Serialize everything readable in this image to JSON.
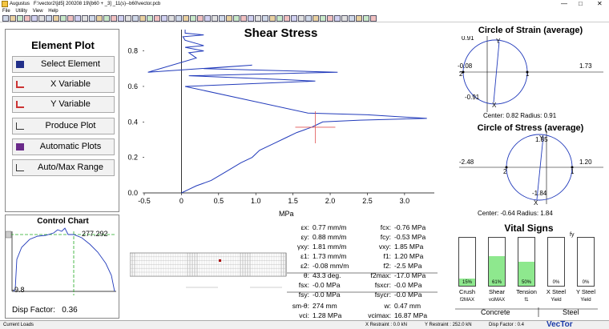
{
  "window": {
    "app_title": "Augustus",
    "path": "F:\\vector2\\[d5] 200208 19\\[b60 + _3] _11(s)--b60\\vector.pcb"
  },
  "menu": [
    "File",
    "Utility",
    "View",
    "Help"
  ],
  "left_panel": {
    "title": "Element Plot",
    "buttons": [
      "Select Element",
      "X Variable",
      "Y Variable",
      "Produce Plot",
      "Automatic Plots",
      "Auto/Max Range"
    ]
  },
  "control_chart": {
    "title": "Control Chart",
    "max_value": "277.292",
    "min_value": "-9.8",
    "disp_factor_label": "Disp Factor:",
    "disp_factor_value": "0.36"
  },
  "main_chart": {
    "title": "Shear Stress",
    "xlabel": "MPa",
    "xticks": [
      "-0.5",
      "0",
      "0.5",
      "1.0",
      "1.5",
      "2.0",
      "2.5",
      "3.0"
    ],
    "yticks": [
      "0.0",
      "0.2",
      "0.4",
      "0.6",
      "0.8"
    ]
  },
  "chart_data": {
    "type": "line",
    "title": "Shear Stress",
    "xlabel": "MPa",
    "xlim": [
      -0.5,
      3.4
    ],
    "ylim": [
      0,
      0.92
    ],
    "series": [
      {
        "x": [
          0.0,
          0.1,
          0.2,
          0.4,
          0.6,
          0.8,
          0.95,
          1.05,
          1.25,
          1.4,
          1.55,
          1.75,
          1.8,
          1.9,
          2.4,
          3.3,
          2.5,
          1.7,
          0.05,
          1.8,
          1.3,
          0.1,
          2.1,
          0.3,
          0.95,
          -0.45,
          0.2,
          0.1,
          0.3,
          0.05,
          0.3,
          0.05,
          0.02,
          0.3,
          0.05,
          0.05
        ],
        "y": [
          0.0,
          0.02,
          0.04,
          0.07,
          0.12,
          0.17,
          0.2,
          0.24,
          0.28,
          0.31,
          0.34,
          0.37,
          0.38,
          0.4,
          0.41,
          0.42,
          0.44,
          0.45,
          0.6,
          0.63,
          0.64,
          0.66,
          0.68,
          0.7,
          0.72,
          0.68,
          0.76,
          0.79,
          0.8,
          0.82,
          0.83,
          0.86,
          0.88,
          0.89,
          0.9,
          0.92
        ]
      }
    ]
  },
  "strain_circle": {
    "title": "Circle of Strain (average)",
    "top_label": "0.91",
    "left_label": "-0.08",
    "right_label": "1.73",
    "bottom_label": "-0.91",
    "pt2": "2",
    "pt1": "1",
    "ptX": "X",
    "ptY": "Y",
    "center": "Center:  0.82  Radius:  0.91"
  },
  "stress_circle": {
    "title": "Circle of Stress (average)",
    "top_label": "1.85",
    "left_label": "-2.48",
    "right_label": "1.20",
    "bottom_label": "-1.84",
    "pt2": "2",
    "pt1": "1",
    "ptX": "X",
    "ptY": "Y",
    "center": "Center:  -0.64  Radius:  1.84"
  },
  "values_left": [
    {
      "label": "εx:",
      "value": "0.77 mm/m"
    },
    {
      "label": "εy:",
      "value": "0.88 mm/m"
    },
    {
      "label": "γxy:",
      "value": "1.81 mm/m"
    },
    {
      "label": "ε1:",
      "value": "1.73 mm/m"
    },
    {
      "label": "ε2:",
      "value": "-0.08 mm/m"
    },
    {
      "label": "θ:",
      "value": "43.3 deg."
    },
    {
      "label": "fsx:",
      "value": "-0.0 MPa"
    },
    {
      "label": "fsy:",
      "value": "-0.0 MPa"
    },
    {
      "label": "sm-θ:",
      "value": "274 mm"
    },
    {
      "label": "vci:",
      "value": "1.28 MPa"
    }
  ],
  "values_right": [
    {
      "label": "fcx:",
      "value": "-0.76 MPa"
    },
    {
      "label": "fcy:",
      "value": "-0.53 MPa"
    },
    {
      "label": "vxy:",
      "value": "1.85 MPa"
    },
    {
      "label": "f1:",
      "value": "1.20 MPa"
    },
    {
      "label": "f2:",
      "value": "-2.5 MPa"
    },
    {
      "label": "f2max:",
      "value": "-17.0 MPa"
    },
    {
      "label": "fsxcr:",
      "value": "-0.0 MPa"
    },
    {
      "label": "fsycr:",
      "value": "-0.0 MPa"
    },
    {
      "label": "w:",
      "value": "0.47 mm"
    },
    {
      "label": "vcimax:",
      "value": "16.87 MPa"
    }
  ],
  "vital_signs": {
    "title": "Vital Signs",
    "fy_label": "fy",
    "bars": [
      {
        "pct": 15,
        "label": "15%",
        "name": "Crush",
        "sub": "f2MAX"
      },
      {
        "pct": 61,
        "label": "61%",
        "name": "Shear",
        "sub": "vciMAX"
      },
      {
        "pct": 50,
        "label": "50%",
        "name": "Tension",
        "sub": "f1"
      },
      {
        "pct": 0,
        "label": "0%",
        "name": "X Steel",
        "sub": "Yield"
      },
      {
        "pct": 0,
        "label": "0%",
        "name": "Y Steel",
        "sub": "Yield"
      }
    ],
    "concrete_label": "Concrete",
    "steel_label": "Steel"
  },
  "status": {
    "left": "Current Loads",
    "x_restraint": "X Restraint :  0.0 kN",
    "y_restraint": "Y Restraint :  252.0 kN",
    "disp_factor": "Disp Factor :  0.4",
    "brand": "VecTor"
  }
}
